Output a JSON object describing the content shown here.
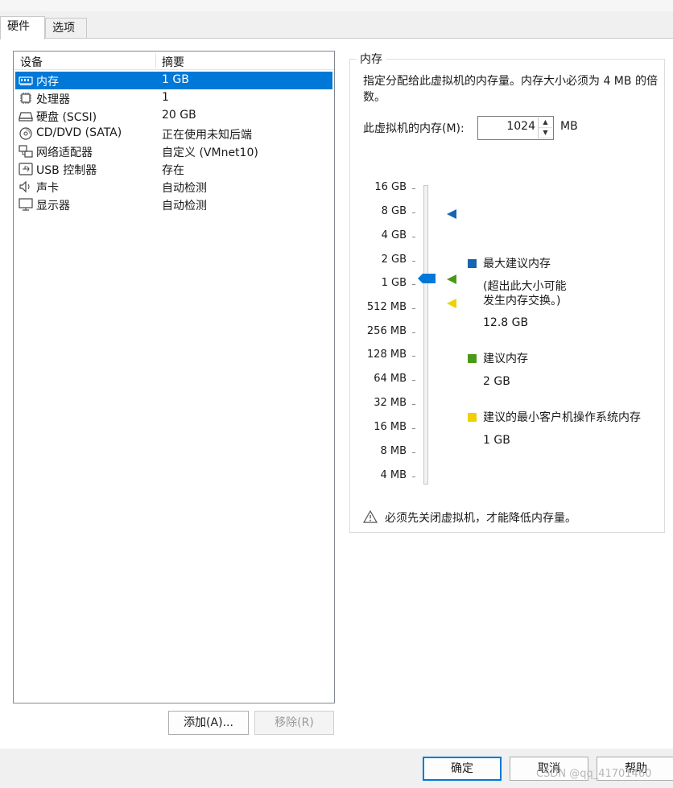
{
  "tabs": [
    {
      "label": "硬件"
    },
    {
      "label": "选项"
    }
  ],
  "device_list": {
    "headers": {
      "device": "设备",
      "summary": "摘要"
    },
    "rows": [
      {
        "name": "内存",
        "summary": "1 GB",
        "icon": "memory-icon",
        "selected": true
      },
      {
        "name": "处理器",
        "summary": "1",
        "icon": "cpu-icon"
      },
      {
        "name": "硬盘 (SCSI)",
        "summary": "20 GB",
        "icon": "hard-disk-icon"
      },
      {
        "name": "CD/DVD (SATA)",
        "summary": "正在使用未知后端",
        "icon": "cd-dvd-icon"
      },
      {
        "name": "网络适配器",
        "summary": "自定义 (VMnet10)",
        "icon": "network-adapter-icon"
      },
      {
        "name": "USB 控制器",
        "summary": "存在",
        "icon": "usb-icon"
      },
      {
        "name": "声卡",
        "summary": "自动检测",
        "icon": "speaker-icon"
      },
      {
        "name": "显示器",
        "summary": "自动检测",
        "icon": "monitor-icon"
      }
    ]
  },
  "buttons": {
    "add": "添加(A)...",
    "remove": "移除(R)",
    "ok": "确定",
    "cancel": "取消",
    "help": "帮助"
  },
  "memory": {
    "group_title": "内存",
    "description": "指定分配给此虚拟机的内存量。内存大小必须为 4 MB 的倍数。",
    "field_label": "此虚拟机的内存(M):",
    "value": "1024",
    "unit": "MB",
    "scale_labels": [
      "16 GB",
      "8 GB",
      "4 GB",
      "2 GB",
      "1 GB",
      "512 MB",
      "256 MB",
      "128 MB",
      "64 MB",
      "32 MB",
      "16 MB",
      "8 MB",
      "4 MB"
    ],
    "current_level": "1 GB",
    "legend": {
      "max_title": "最大建议内存",
      "max_note_line1": "(超出此大小可能",
      "max_note_line2": "发生内存交换。)",
      "max_value": "12.8 GB",
      "rec_title": "建议内存",
      "rec_value": "2 GB",
      "min_title": "建议的最小客户机操作系统内存",
      "min_value": "1 GB"
    },
    "warning": "必须先关闭虚拟机，才能降低内存量。"
  },
  "colors": {
    "accent": "#0078d7",
    "max_marker": "#1565b0",
    "rec_marker": "#4a9a1a",
    "min_marker": "#f0d000"
  },
  "watermark": "CSDN @qq_41701460"
}
